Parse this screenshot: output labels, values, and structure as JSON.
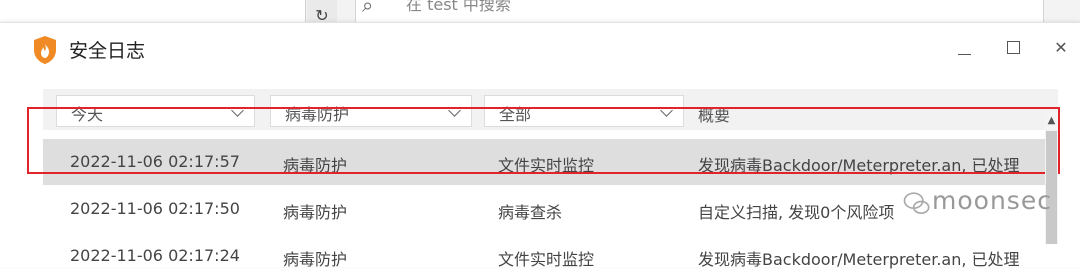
{
  "background": {
    "toolbar_button_glyph": "↻",
    "search_placeholder": "在 test 中搜索"
  },
  "dialog": {
    "title": "安全日志",
    "logo_icon": "shield-flame-icon",
    "brand_color": "#f08a24",
    "minimize_icon": "minimize-icon",
    "maximize_icon": "maximize-icon",
    "close_glyph": "✕"
  },
  "filters": {
    "date": "今天",
    "category": "病毒防护",
    "type": "全部",
    "summary_header": "概要"
  },
  "rows": [
    {
      "time": "2022-11-06 02:17:57",
      "category": "病毒防护",
      "source": "文件实时监控",
      "summary": "发现病毒Backdoor/Meterpreter.an, 已处理"
    },
    {
      "time": "2022-11-06 02:17:50",
      "category": "病毒防护",
      "source": "病毒查杀",
      "summary": "自定义扫描, 发现0个风险项"
    },
    {
      "time": "2022-11-06 02:17:24",
      "category": "病毒防护",
      "source": "文件实时监控",
      "summary": "发现病毒Backdoor/Meterpreter.an, 已处理"
    }
  ],
  "selection": {
    "row_index": 0,
    "highlight_color": "#e0242a"
  },
  "watermark": {
    "text": "moonsec"
  }
}
